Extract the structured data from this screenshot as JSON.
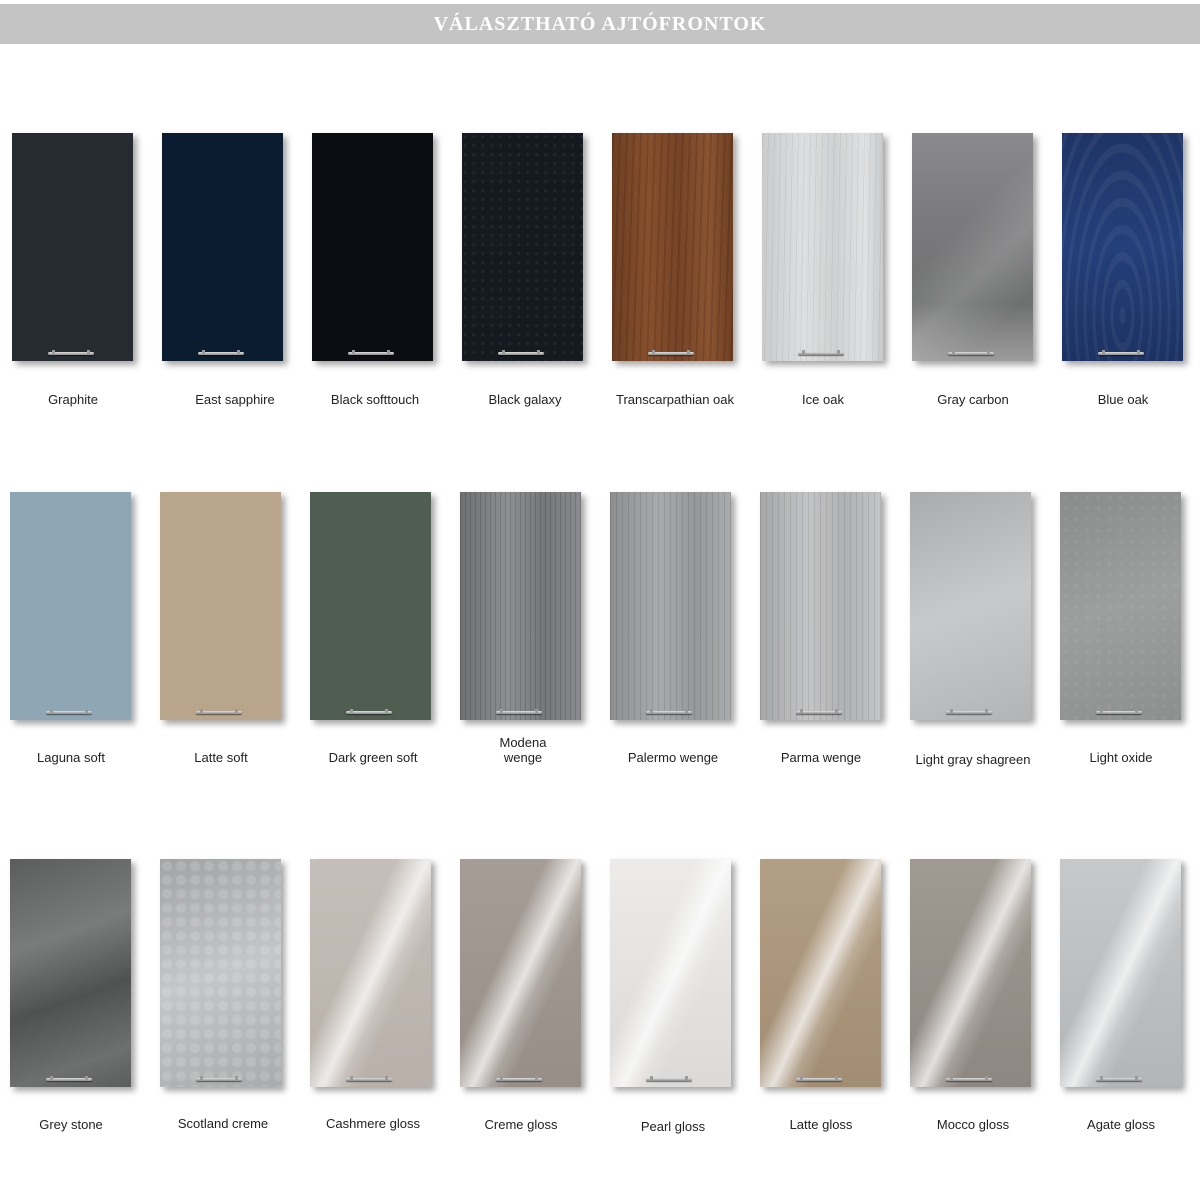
{
  "header": {
    "title": "VÁLASZTHATÓ AJTÓFRONTOK"
  },
  "rows": [
    {
      "items": [
        {
          "label": "Graphite",
          "color": "#262a31"
        },
        {
          "label": "East sapphire",
          "color": "#0b1b30"
        },
        {
          "label": "Black softtouch",
          "color": "#0b0d13"
        },
        {
          "label": "Black galaxy",
          "color": "#151a21"
        },
        {
          "label": "Transcarpathian oak",
          "color": "#7a4627"
        },
        {
          "label": "Ice oak",
          "color": "#d4d6d7"
        },
        {
          "label": "Gray carbon",
          "color": "#7e7e80"
        },
        {
          "label": "Blue oak",
          "color": "#223b72"
        }
      ]
    },
    {
      "items": [
        {
          "label": "Laguna soft",
          "color": "#8fa7b4"
        },
        {
          "label": "Latte soft",
          "color": "#b9a58c"
        },
        {
          "label": "Dark green soft",
          "color": "#4f5e51"
        },
        {
          "label": "Modena\nwenge",
          "color": "#7e8083"
        },
        {
          "label": "Palermo wenge",
          "color": "#9c9d9e"
        },
        {
          "label": "Parma wenge",
          "color": "#b7b8b9"
        },
        {
          "label": "Light gray shagreen",
          "color": "#b9bbbc"
        },
        {
          "label": "Light oxide",
          "color": "#939494"
        }
      ]
    },
    {
      "items": [
        {
          "label": "Grey stone",
          "color": "#626564"
        },
        {
          "label": "Scotland creme",
          "color": "#b3b6b7"
        },
        {
          "label": "Cashmere gloss",
          "color": "#c1bab4"
        },
        {
          "label": "Creme gloss",
          "color": "#9f968f"
        },
        {
          "label": "Pearl gloss",
          "color": "#e6e5e3"
        },
        {
          "label": "Latte gloss",
          "color": "#ab977c"
        },
        {
          "label": "Mocco gloss",
          "color": "#98918b"
        },
        {
          "label": "Agate gloss",
          "color": "#bdc0c2"
        }
      ]
    }
  ]
}
